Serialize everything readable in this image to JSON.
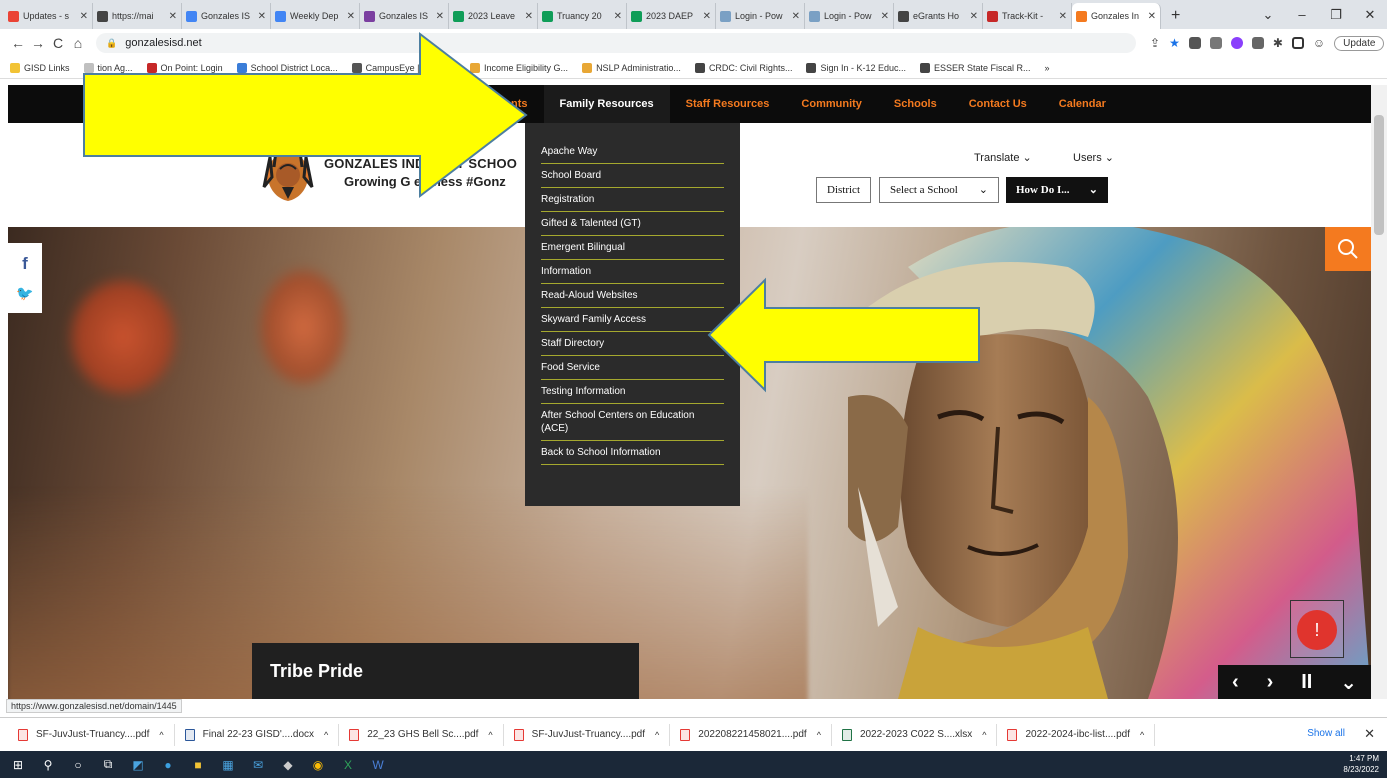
{
  "browser": {
    "tabs": [
      {
        "title": "Updates - s",
        "color": "#ea4335"
      },
      {
        "title": "https://mai",
        "color": "#444444"
      },
      {
        "title": "Gonzales IS",
        "color": "#4285f4"
      },
      {
        "title": "Weekly Dep",
        "color": "#4285f4"
      },
      {
        "title": "Gonzales IS",
        "color": "#7b3fa0"
      },
      {
        "title": "2023 Leave",
        "color": "#0f9d58"
      },
      {
        "title": "Truancy 20",
        "color": "#0f9d58"
      },
      {
        "title": "2023 DAEP",
        "color": "#0f9d58"
      },
      {
        "title": "Login - Pow",
        "color": "#7aa0c4"
      },
      {
        "title": "Login - Pow",
        "color": "#7aa0c4"
      },
      {
        "title": "eGrants Ho",
        "color": "#444444"
      },
      {
        "title": "Track-Kit -",
        "color": "#c62828"
      },
      {
        "title": "Gonzales In",
        "color": "#f47a1f",
        "active": true
      }
    ],
    "new_tab": "+",
    "window_controls": [
      "⌄",
      "–",
      "❐",
      "✕"
    ],
    "url": "gonzalesisd.net",
    "update_label": "Update",
    "bookmarks": [
      "GISD Links",
      "tion Ag...",
      "On Point: Login",
      "School District Loca...",
      "CampusEye | Enterp...",
      "Income Eligibility G...",
      "NSLP Administratio...",
      "CRDC: Civil Rights...",
      "Sign In - K-12 Educ...",
      "ESSER State Fiscal R..."
    ],
    "more_bookmarks": "»",
    "status_url": "https://www.gonzalesisd.net/domain/1445"
  },
  "site": {
    "nav": [
      {
        "label": "nts",
        "active": false
      },
      {
        "label": "Family Resources",
        "active": true
      },
      {
        "label": "Staff Resources",
        "active": false
      },
      {
        "label": "Community",
        "active": false
      },
      {
        "label": "Schools",
        "active": false
      },
      {
        "label": "Contact Us",
        "active": false
      },
      {
        "label": "Calendar",
        "active": false
      }
    ],
    "school_title": "GONZALES IND  DENT SCHOO",
    "school_motto": "Growing G  eatness #Gonz",
    "translate_label": "Translate",
    "users_label": "Users",
    "district_label": "District",
    "select_school_label": "Select a School",
    "how_do_i_label": "How Do I...",
    "dropdown_items": [
      "Apache Way",
      "School Board",
      "Registration",
      "Gifted & Talented (GT)",
      "Emergent Bilingual",
      "Information",
      "Read-Aloud Websites",
      "Skyward Family Access",
      "Staff Directory",
      "Food Service",
      "Testing Information",
      "After School Centers on Education (ACE)",
      "Back to School Information"
    ],
    "hero_caption": "Tribe Pride",
    "alert_symbol": "!",
    "slide_controls": [
      "‹",
      "›",
      "II",
      "⌄"
    ],
    "social": {
      "facebook": "f",
      "twitter": "🐦"
    }
  },
  "downloads": [
    {
      "name": "SF-JuvJust-Truancy....pdf",
      "color": "#e53935"
    },
    {
      "name": "Final 22-23 GISD'....docx",
      "color": "#2b579a"
    },
    {
      "name": "22_23 GHS Bell Sc....pdf",
      "color": "#e53935"
    },
    {
      "name": "SF-JuvJust-Truancy....pdf",
      "color": "#e53935"
    },
    {
      "name": "202208221458021....pdf",
      "color": "#e53935"
    },
    {
      "name": "2022-2023 C022 S....xlsx",
      "color": "#217346"
    },
    {
      "name": "2022-2024-ibc-list....pdf",
      "color": "#e53935"
    }
  ],
  "downloads_show_all": "Show all",
  "downloads_close": "✕",
  "taskbar": {
    "time": "1:47 PM",
    "date": "8/23/2022"
  },
  "colors": {
    "accent": "#f47a1f",
    "nav_bg": "#0c0c0c",
    "dropdown_bg": "#2b2b2b",
    "dropdown_divider": "#a5a82e",
    "arrow_fill": "#ffff00"
  }
}
